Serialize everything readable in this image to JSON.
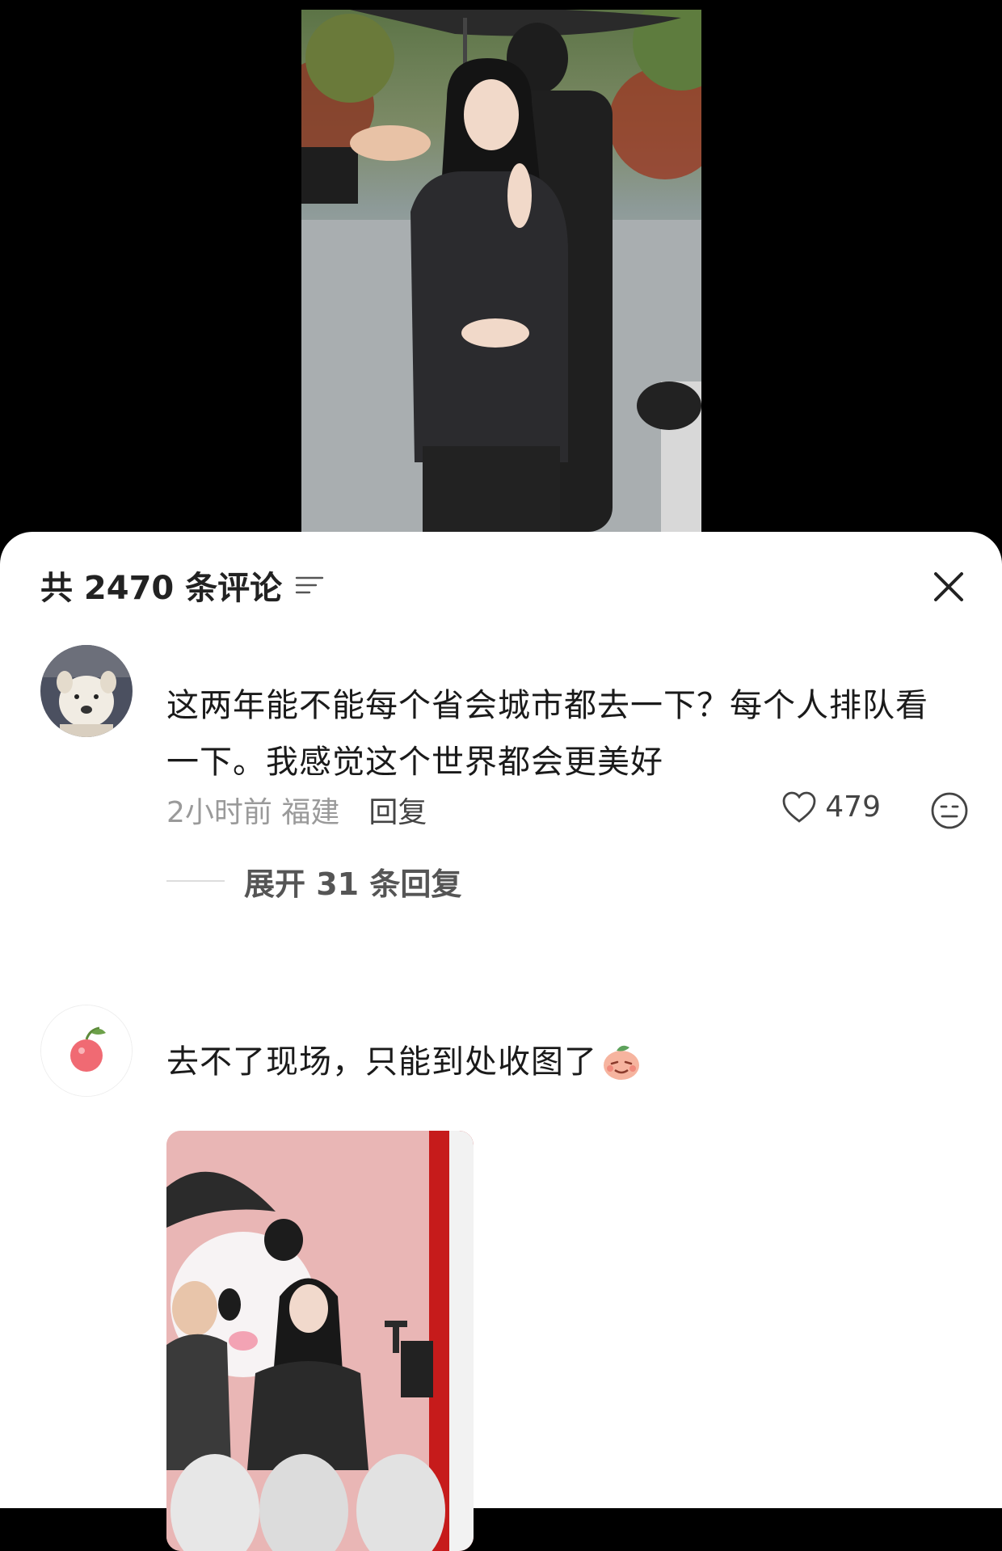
{
  "header": {
    "title": "共 2470 条评论"
  },
  "comments": [
    {
      "text": "这两年能不能每个省会城市都去一下？每个人排队看一下。我感觉这个世界都会更美好",
      "time_location": "2小时前 福建",
      "reply_label": "回复",
      "like_count": "479",
      "expand_label": "展开 31 条回复"
    },
    {
      "text": "去不了现场，只能到处收图了"
    }
  ],
  "icons": {
    "filter": "filter-icon",
    "close": "close-icon",
    "like": "heart-outline-icon",
    "reaction": "meh-face-icon",
    "emoji": "peach-face-emoji-icon",
    "avatar1": "dog-avatar",
    "avatar2": "lychee-avatar"
  },
  "colors": {
    "sheet_bg": "#ffffff",
    "text": "#1a1a1a",
    "meta": "#9a9a9a"
  }
}
